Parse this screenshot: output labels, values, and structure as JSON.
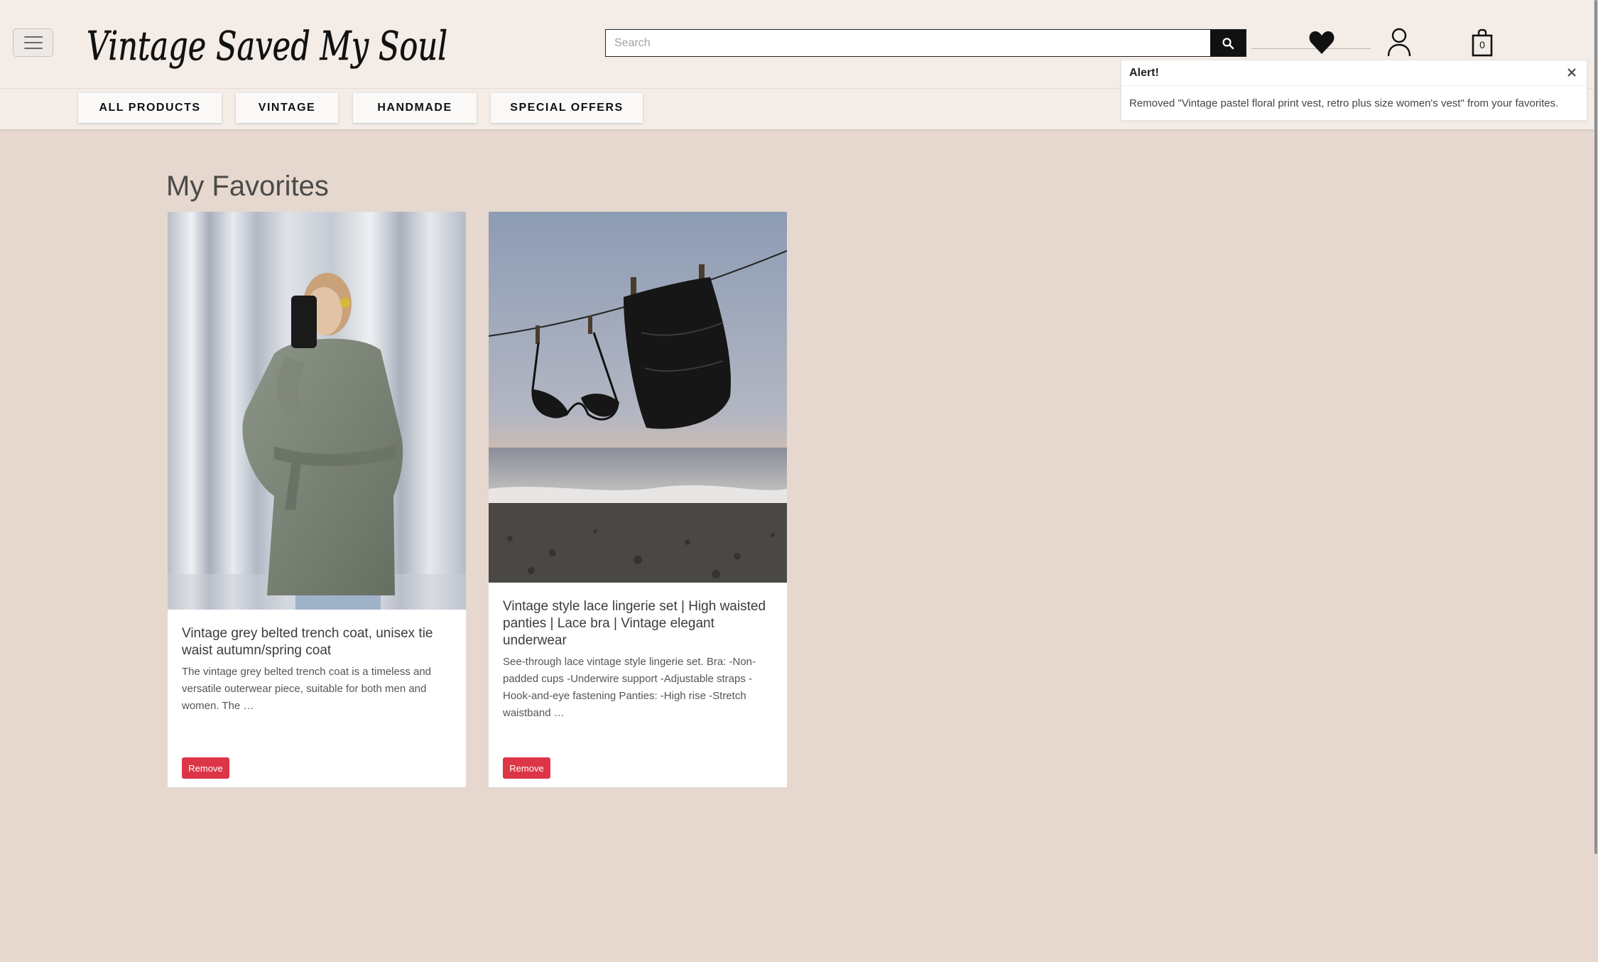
{
  "header": {
    "logo_text": "Vintage Saved My Soul",
    "search": {
      "placeholder": "Search",
      "value": ""
    },
    "cart_count": "0",
    "icons": {
      "menu": "hamburger-icon",
      "search": "search-icon",
      "favorites": "heart-icon",
      "account": "user-icon",
      "cart": "shopping-bag-icon"
    }
  },
  "nav": {
    "items": [
      {
        "label": "ALL PRODUCTS"
      },
      {
        "label": "VINTAGE"
      },
      {
        "label": "HANDMADE"
      },
      {
        "label": "SPECIAL OFFERS"
      }
    ]
  },
  "alert": {
    "title": "Alert!",
    "message": "Removed \"Vintage pastel floral print vest, retro plus size women's vest\" from your favorites."
  },
  "main": {
    "title": "My Favorites",
    "products": [
      {
        "title": "Vintage grey belted trench coat, unisex tie waist autumn/spring coat",
        "description": "The vintage grey belted trench coat is a timeless and versatile outerwear piece, suitable for both men and women. The …",
        "remove_label": "Remove"
      },
      {
        "title": "Vintage style lace lingerie set | High waisted panties | Lace bra | Vintage elegant underwear",
        "description": "See-through lace vintage style lingerie set. Bra: -Non-padded cups -Underwire support -Adjustable straps -Hook-and-eye fastening Panties: -High rise -Stretch waistband …",
        "remove_label": "Remove"
      }
    ]
  },
  "colors": {
    "background": "#e6d8ce",
    "header": "#f3ece7",
    "remove": "#dc3545"
  }
}
